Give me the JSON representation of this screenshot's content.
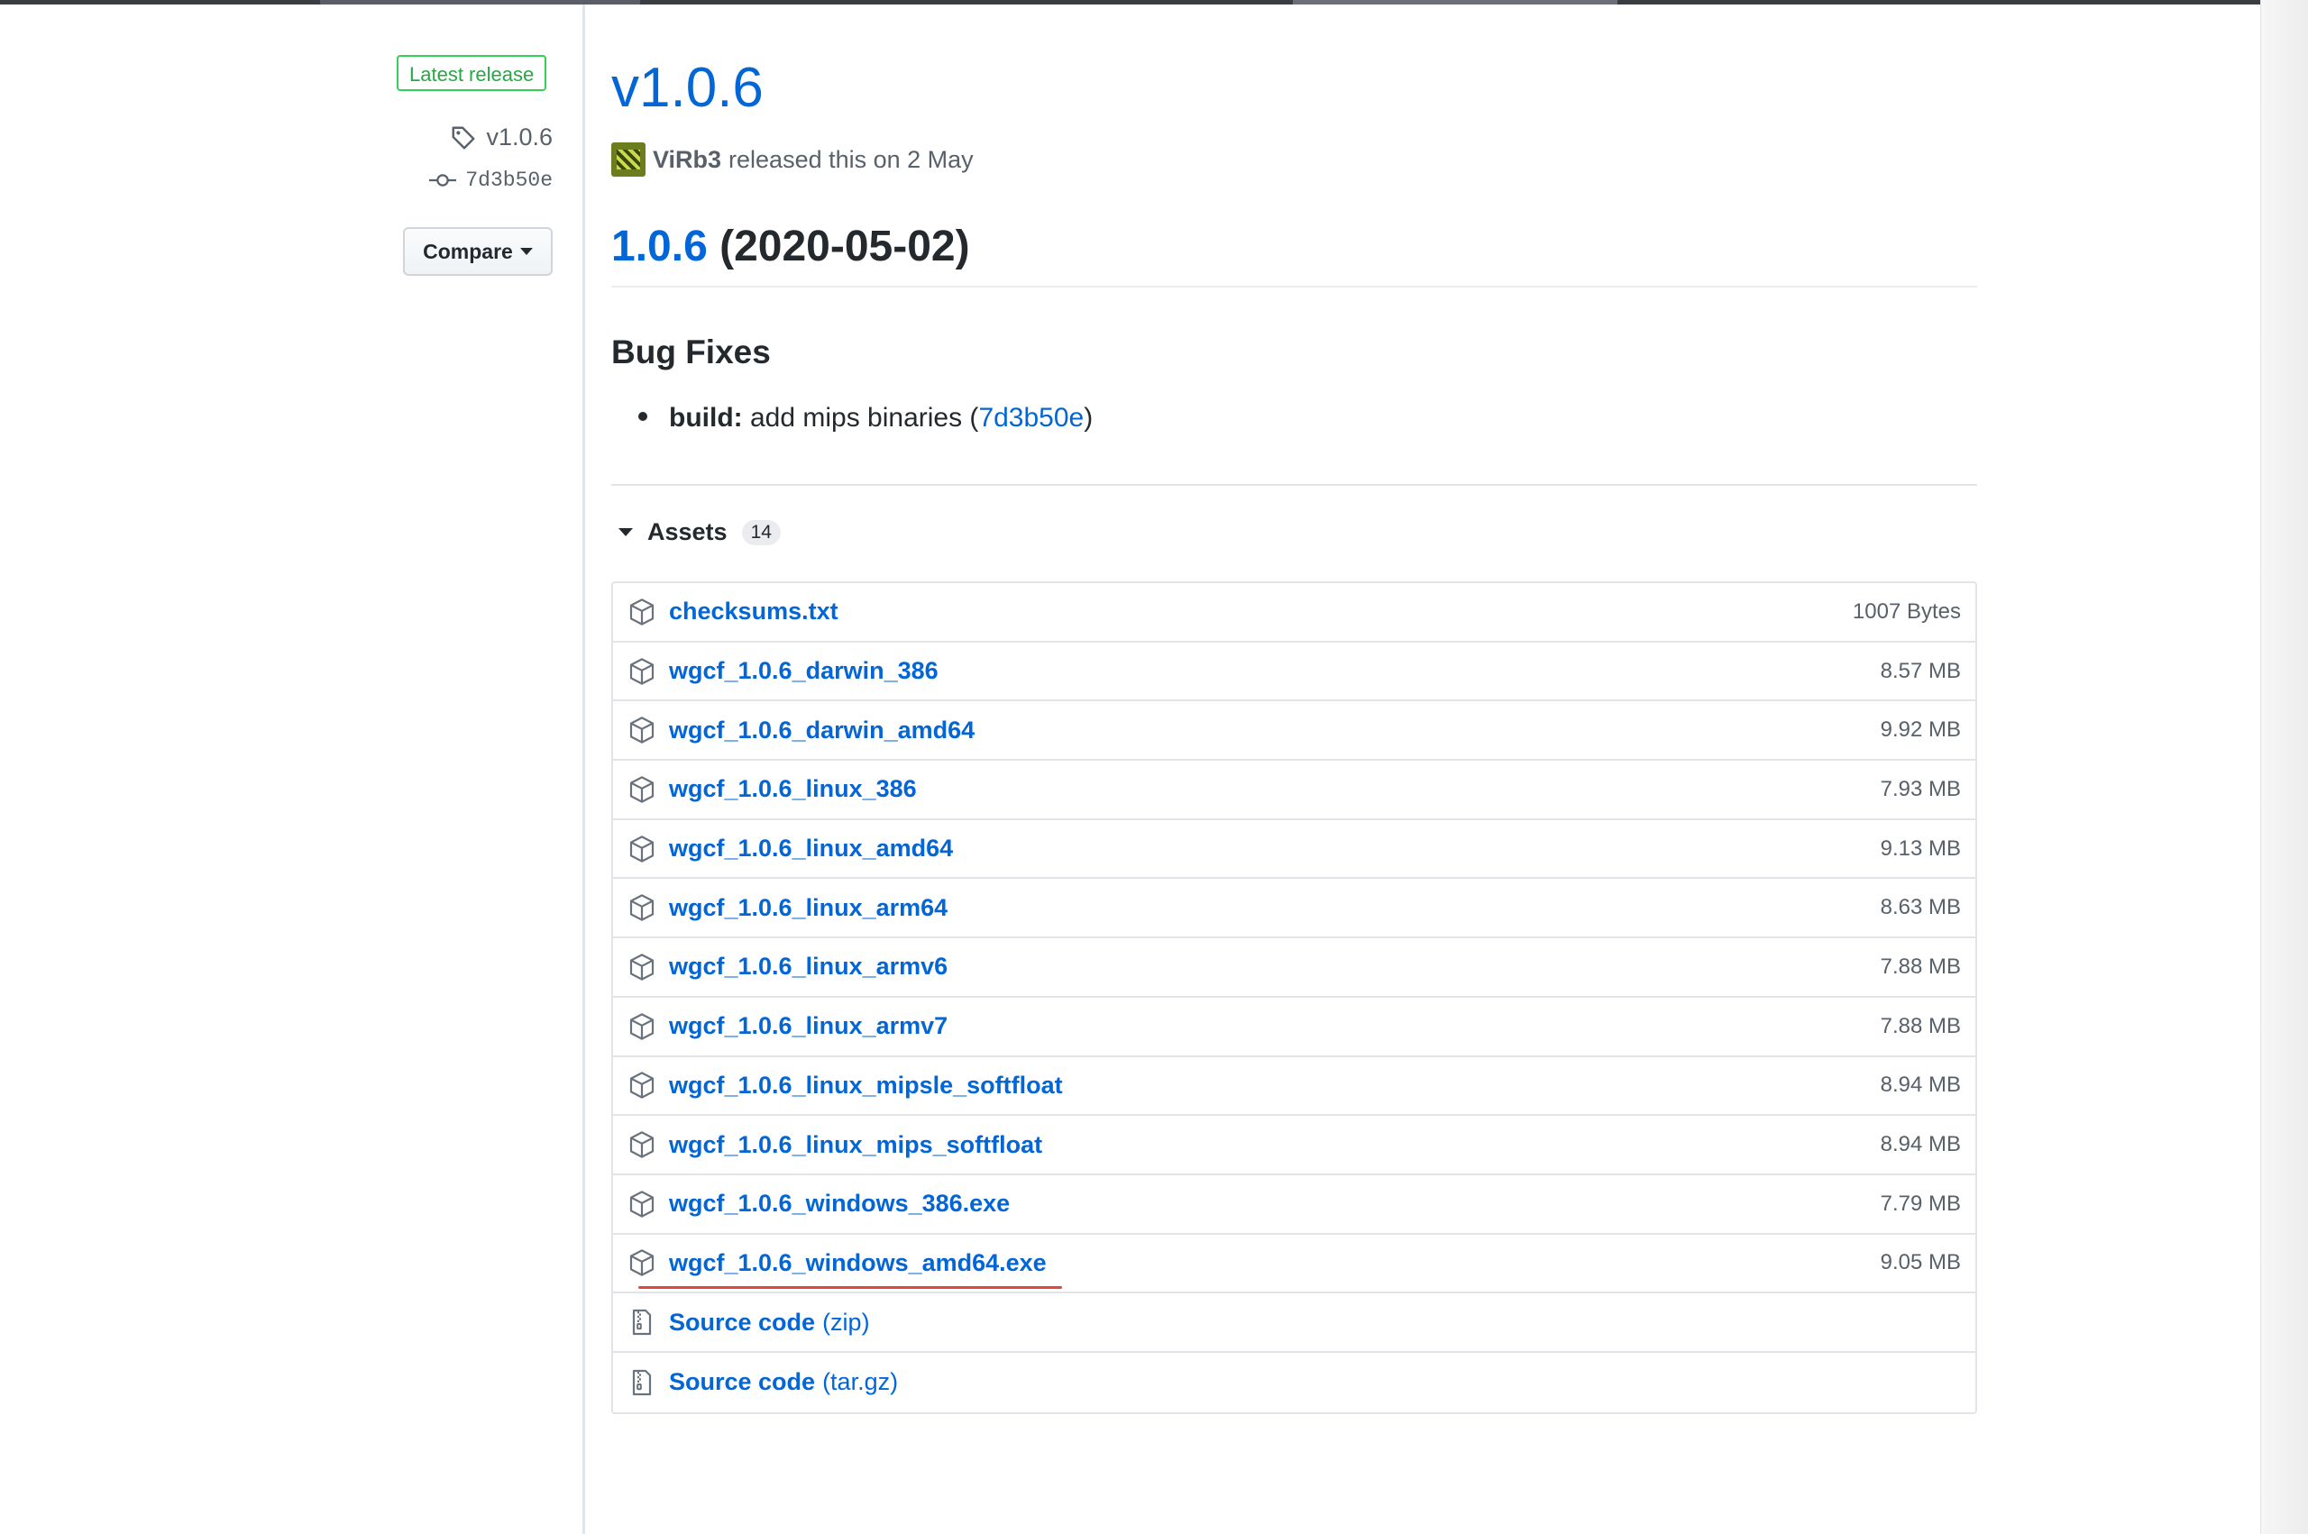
{
  "sidebar": {
    "latest_badge": "Latest release",
    "tag": "v1.0.6",
    "commit": "7d3b50e",
    "compare_label": "Compare"
  },
  "release": {
    "title": "v1.0.6",
    "author": "ViRb3",
    "released_text": "released this on 2 May",
    "heading_version": "1.0.6",
    "heading_date": " (2020-05-02)",
    "bugfix_title": "Bug Fixes",
    "bugfix_item": {
      "scope": "build:",
      "text": " add mips binaries (",
      "commit": "7d3b50e",
      "close": ")"
    }
  },
  "assets": {
    "label": "Assets",
    "count": "14",
    "items": [
      {
        "name": "checksums.txt",
        "size": "1007 Bytes"
      },
      {
        "name": "wgcf_1.0.6_darwin_386",
        "size": "8.57 MB"
      },
      {
        "name": "wgcf_1.0.6_darwin_amd64",
        "size": "9.92 MB"
      },
      {
        "name": "wgcf_1.0.6_linux_386",
        "size": "7.93 MB"
      },
      {
        "name": "wgcf_1.0.6_linux_amd64",
        "size": "9.13 MB"
      },
      {
        "name": "wgcf_1.0.6_linux_arm64",
        "size": "8.63 MB"
      },
      {
        "name": "wgcf_1.0.6_linux_armv6",
        "size": "7.88 MB"
      },
      {
        "name": "wgcf_1.0.6_linux_armv7",
        "size": "7.88 MB"
      },
      {
        "name": "wgcf_1.0.6_linux_mipsle_softfloat",
        "size": "8.94 MB"
      },
      {
        "name": "wgcf_1.0.6_linux_mips_softfloat",
        "size": "8.94 MB"
      },
      {
        "name": "wgcf_1.0.6_windows_386.exe",
        "size": "7.79 MB"
      },
      {
        "name": "wgcf_1.0.6_windows_amd64.exe",
        "size": "9.05 MB"
      }
    ],
    "source": [
      {
        "name": "Source code",
        "suffix": "(zip)"
      },
      {
        "name": "Source code",
        "suffix": "(tar.gz)"
      }
    ]
  },
  "colors": {
    "link": "#0366d6",
    "badge_green": "#28a745",
    "highlight_underline": "#e0483e"
  }
}
